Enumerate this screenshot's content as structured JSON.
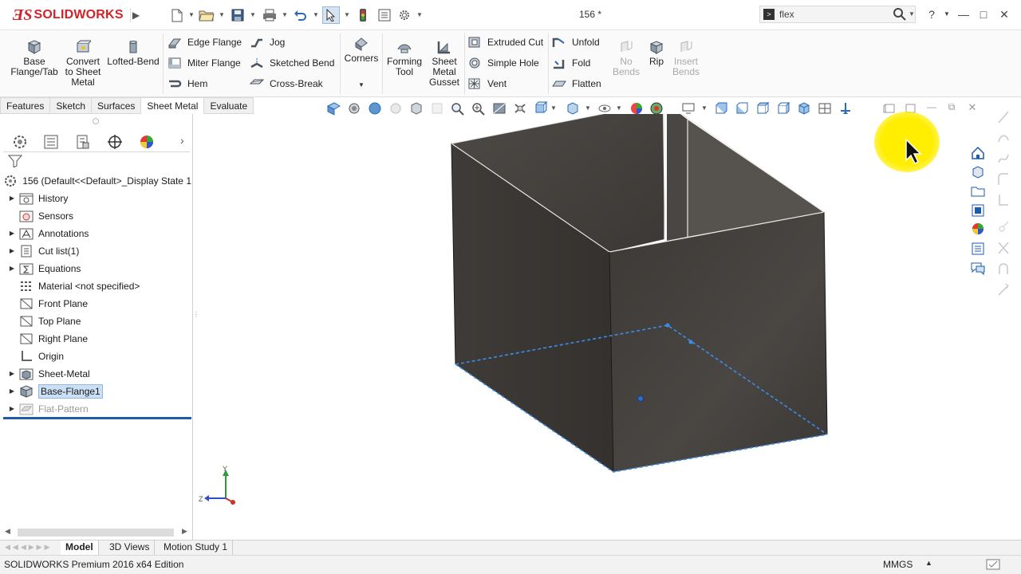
{
  "app": {
    "logo_prefix": "ƎS",
    "logo_name": "SOLIDWORKS",
    "document_title": "156 *"
  },
  "search": {
    "value": "flex",
    "placeholder": ""
  },
  "ribbon": {
    "base_flange": "Base Flange/Tab",
    "convert": "Convert to Sheet Metal",
    "lofted_bend": "Lofted-Bend",
    "edge_flange": "Edge Flange",
    "miter_flange": "Miter Flange",
    "hem": "Hem",
    "jog": "Jog",
    "sketched_bend": "Sketched Bend",
    "cross_break": "Cross-Break",
    "corners": "Corners",
    "forming_tool": "Forming Tool",
    "sheet_metal_gusset": "Sheet Metal Gusset",
    "extruded_cut": "Extruded Cut",
    "simple_hole": "Simple Hole",
    "vent": "Vent",
    "unfold": "Unfold",
    "fold": "Fold",
    "flatten": "Flatten",
    "no_bends": "No Bends",
    "rip": "Rip",
    "insert_bends": "Insert Bends"
  },
  "tabs": [
    "Features",
    "Sketch",
    "Surfaces",
    "Sheet Metal",
    "Evaluate"
  ],
  "tree": {
    "root": "156  (Default<<Default>_Display State 1",
    "items": [
      {
        "label": "History",
        "icon": "history-folder-icon"
      },
      {
        "label": "Sensors",
        "icon": "sensors-icon"
      },
      {
        "label": "Annotations",
        "icon": "annotations-icon"
      },
      {
        "label": "Cut list(1)",
        "icon": "cut-list-icon"
      },
      {
        "label": "Equations",
        "icon": "equations-icon"
      },
      {
        "label": "Material <not specified>",
        "icon": "material-icon"
      },
      {
        "label": "Front Plane",
        "icon": "plane-icon"
      },
      {
        "label": "Top Plane",
        "icon": "plane-icon"
      },
      {
        "label": "Right Plane",
        "icon": "plane-icon"
      },
      {
        "label": "Origin",
        "icon": "origin-icon"
      },
      {
        "label": "Sheet-Metal",
        "icon": "sheet-metal-folder-icon"
      },
      {
        "label": "Base-Flange1",
        "icon": "base-flange-icon"
      },
      {
        "label": "Flat-Pattern",
        "icon": "flat-pattern-icon"
      }
    ]
  },
  "bottom_tabs": [
    "Model",
    "3D Views",
    "Motion Study 1"
  ],
  "status": {
    "left": "SOLIDWORKS Premium 2016 x64 Edition",
    "units": "MMGS"
  },
  "triad": {
    "y": "Y",
    "z": "Z"
  },
  "colors": {
    "brand_red": "#d2232a",
    "selection_blue": "#1e5aa8",
    "model_dark": "#3d3a37",
    "edge_highlight": "#3b8fe8",
    "cursor_halo": "#ffee00"
  }
}
